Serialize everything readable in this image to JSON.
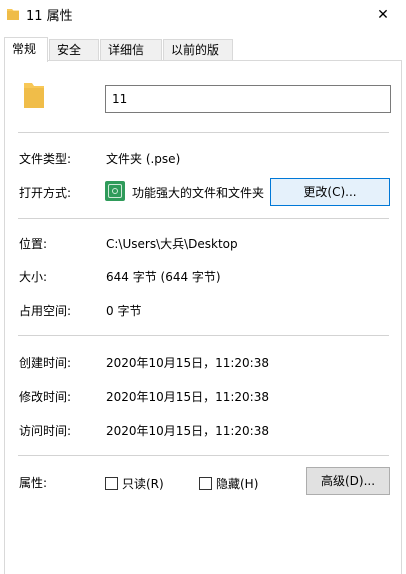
{
  "window": {
    "title": "11 属性",
    "close_glyph": "✕"
  },
  "tabs": [
    {
      "label": "常规",
      "active": true
    },
    {
      "label": "安全",
      "active": false
    },
    {
      "label": "详细信息",
      "active": false
    },
    {
      "label": "以前的版本",
      "active": false
    }
  ],
  "general": {
    "name_value": "11",
    "file_type_label": "文件类型:",
    "file_type_value": "文件夹 (.pse)",
    "open_with_label": "打开方式:",
    "open_with_value": "功能强大的文件和文件夹",
    "change_button": "更改(C)...",
    "location_label": "位置:",
    "location_value": "C:\\Users\\大兵\\Desktop",
    "size_label": "大小:",
    "size_value": "644 字节 (644 字节)",
    "disk_size_label": "占用空间:",
    "disk_size_value": "0 字节",
    "created_label": "创建时间:",
    "created_value": "2020年10月15日，11:20:38",
    "modified_label": "修改时间:",
    "modified_value": "2020年10月15日，11:20:38",
    "accessed_label": "访问时间:",
    "accessed_value": "2020年10月15日，11:20:38",
    "attributes_label": "属性:",
    "readonly_label": "只读(R)",
    "hidden_label": "隐藏(H)",
    "advanced_button": "高级(D)..."
  },
  "colors": {
    "folder": "#f8c857",
    "folder_dark": "#e9b43e",
    "accent": "#0078d7",
    "app_icon": "#2f9b5a"
  }
}
